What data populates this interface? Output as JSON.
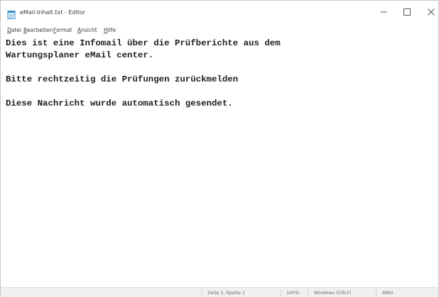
{
  "window": {
    "title": "eMail-Inhalt.txt - Editor",
    "app_icon": "notepad-icon"
  },
  "titlebar_buttons": {
    "minimize": "minimize-icon",
    "maximize": "maximize-icon",
    "close": "close-icon"
  },
  "menu": {
    "items": [
      "Datei",
      "Bearbeiten",
      "Format",
      "Ansicht",
      "Hilfe"
    ]
  },
  "document": {
    "lines": [
      "Dies ist eine Infomail über die Prüfberichte aus dem",
      "Wartungsplaner eMail center.",
      "",
      "Bitte rechtzeitig die Prüfungen zurückmelden",
      "",
      "Diese Nachricht wurde automatisch gesendet."
    ]
  },
  "statusbar": {
    "position": "Zeile 1, Spalte 1",
    "zoom": "100%",
    "line_ending": "Windows (CRLF)",
    "encoding": "ANSI"
  }
}
